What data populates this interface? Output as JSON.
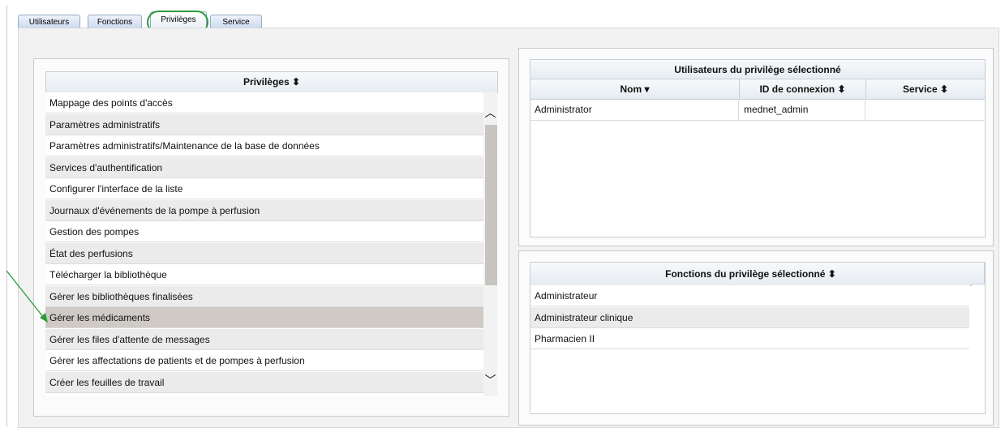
{
  "tabs": [
    {
      "label": "Utilisateurs"
    },
    {
      "label": "Fonctions"
    },
    {
      "label": "Privilèges"
    },
    {
      "label": "Service"
    }
  ],
  "privileges": {
    "header": "Privilèges ⬍",
    "items": [
      "Mappage des points d'accès",
      "Paramètres administratifs",
      "Paramètres administratifs/Maintenance de la base de données",
      "Services d'authentification",
      "Configurer l'interface de la liste",
      "Journaux d'événements de la pompe à perfusion",
      "Gestion des pompes",
      "État des perfusions",
      "Télécharger la bibliothèque",
      "Gérer les bibliothèques finalisées",
      "Gérer les médicaments",
      "Gérer les files d'attente de messages",
      "Gérer les affectations de patients et de pompes à perfusion",
      "Créer les feuilles de travail"
    ],
    "selected_index": 10
  },
  "users_panel": {
    "title": "Utilisateurs du privilège sélectionné",
    "columns": [
      "Nom ▾",
      "ID de connexion ⬍",
      "Service ⬍"
    ],
    "rows": [
      [
        "Administrator",
        "mednet_admin",
        ""
      ]
    ]
  },
  "roles_panel": {
    "title": "Fonctions du privilège sélectionné ⬍",
    "rows": [
      "Administrateur",
      "Administrateur clinique",
      "Pharmacien II"
    ]
  },
  "colors": {
    "highlight": "#2f9a3a",
    "arrow": "#2f9a3a"
  }
}
